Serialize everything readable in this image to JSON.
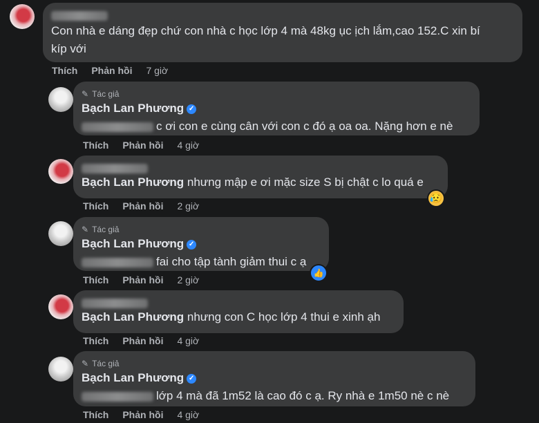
{
  "actions": {
    "like": "Thích",
    "reply": "Phản hồi"
  },
  "author_tag": "Tác giả",
  "comments": [
    {
      "text": "Con nhà e dáng đẹp chứ con nhà c học lớp 4 mà 48kg ục ịch lắm,cao 152.C xin bí",
      "text2": "kíp với",
      "time": "7 giờ"
    },
    {
      "author": "Bạch Lan Phương",
      "text": "c ơi con e cùng cân với con c đó ạ oa oa. Nặng hơn e nè",
      "time": "4 giờ"
    },
    {
      "mention": "Bạch Lan Phương",
      "text": "nhưng mập e ơi mặc size S bị chật c lo quá e",
      "time": "2 giờ",
      "reaction": "😥"
    },
    {
      "author": "Bạch Lan Phương",
      "text": "fai cho tập tành giảm thui c ạ",
      "time": "2 giờ",
      "reaction": "👍"
    },
    {
      "mention": "Bạch Lan Phương",
      "text": "nhưng con C học lớp 4 thui e xinh ạh",
      "time": "4 giờ"
    },
    {
      "author": "Bạch Lan Phương",
      "text": "lớp 4 mà đã 1m52 là cao đó c ạ. Ry nhà e 1m50 nè c nè",
      "time": "4 giờ"
    }
  ]
}
